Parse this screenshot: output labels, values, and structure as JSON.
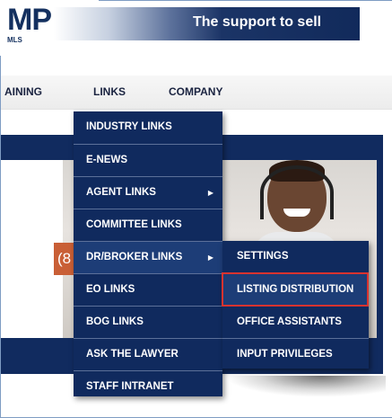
{
  "header": {
    "logo_text": "MP",
    "logo_sub": "MLS",
    "tagline": "The support to sell"
  },
  "nav": {
    "items": [
      {
        "label": "AINING"
      },
      {
        "label": "LINKS"
      },
      {
        "label": "COMPANY"
      }
    ]
  },
  "content": {
    "badge_text": "(8"
  },
  "links_menu": {
    "items": [
      {
        "label": "INDUSTRY LINKS",
        "has_submenu": false
      },
      {
        "label": "E-NEWS",
        "has_submenu": false
      },
      {
        "label": "AGENT LINKS",
        "has_submenu": true
      },
      {
        "label": "COMMITTEE LINKS",
        "has_submenu": false
      },
      {
        "label": "DR/BROKER LINKS",
        "has_submenu": true
      },
      {
        "label": "EO LINKS",
        "has_submenu": false
      },
      {
        "label": "BOG LINKS",
        "has_submenu": false
      },
      {
        "label": "ASK THE LAWYER",
        "has_submenu": false
      },
      {
        "label": "STAFF INTRANET",
        "has_submenu": false
      }
    ]
  },
  "broker_submenu": {
    "items": [
      {
        "label": "SETTINGS"
      },
      {
        "label": "LISTING DISTRIBUTION",
        "highlighted": true
      },
      {
        "label": "OFFICE ASSISTANTS"
      },
      {
        "label": "INPUT PRIVILEGES"
      }
    ]
  },
  "colors": {
    "menu_bg": "#102a5e",
    "highlight_border": "#d8332f",
    "badge": "#c95f36"
  },
  "icons": {
    "submenu_arrow": "chevron-right-icon"
  }
}
